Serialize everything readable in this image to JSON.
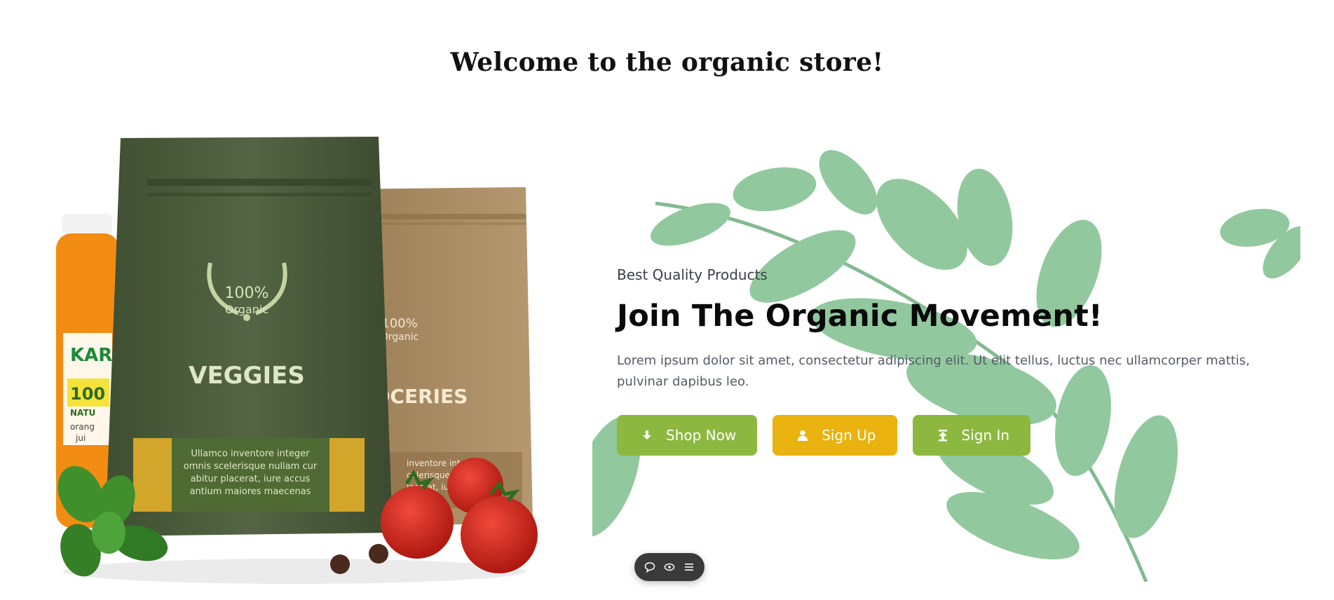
{
  "page": {
    "title": "Welcome to the organic store!"
  },
  "product_art": {
    "bag_front": {
      "badge_top": "100%",
      "badge_bottom": "Organic",
      "name": "VEGGIES",
      "label_lines": [
        "Ullamco inventore integer",
        "omnis scelerisque nullam cur",
        "abitur placerat, iure accus",
        "antium maiores maecenas"
      ]
    },
    "bag_back": {
      "badge_top": "100%",
      "badge_bottom": "Organic",
      "name": "OCERIES",
      "label_lines": [
        "inventore integer",
        "celerisque null",
        "lacerat, iure"
      ]
    },
    "jar": {
      "brand": "KAR",
      "big": "100",
      "sub": "NATU",
      "line1": "orang",
      "line2": "jui"
    },
    "colors": {
      "bag_front": "#4d5e3c",
      "bag_back": "#a88a61",
      "jar": "#f28c12",
      "tomato": "#d8261a",
      "basil": "#3f8f2d"
    }
  },
  "hero": {
    "kicker": "Best Quality Products",
    "headline": "Join The Organic Movement!",
    "lead": "Lorem ipsum dolor sit amet, consectetur adipiscing elit. Ut elit tellus, luctus nec ullamcorper mattis, pulvinar dapibus leo.",
    "buttons": [
      {
        "label": "Shop Now",
        "icon": "download-icon",
        "color": "#8cb83f"
      },
      {
        "label": "Sign Up",
        "icon": "user-icon",
        "color": "#e9b20e"
      },
      {
        "label": "Sign In",
        "icon": "upload-icon",
        "color": "#8cb83f"
      }
    ]
  },
  "dock": {
    "icons": [
      "chat-icon",
      "eye-icon",
      "menu-icon"
    ]
  }
}
